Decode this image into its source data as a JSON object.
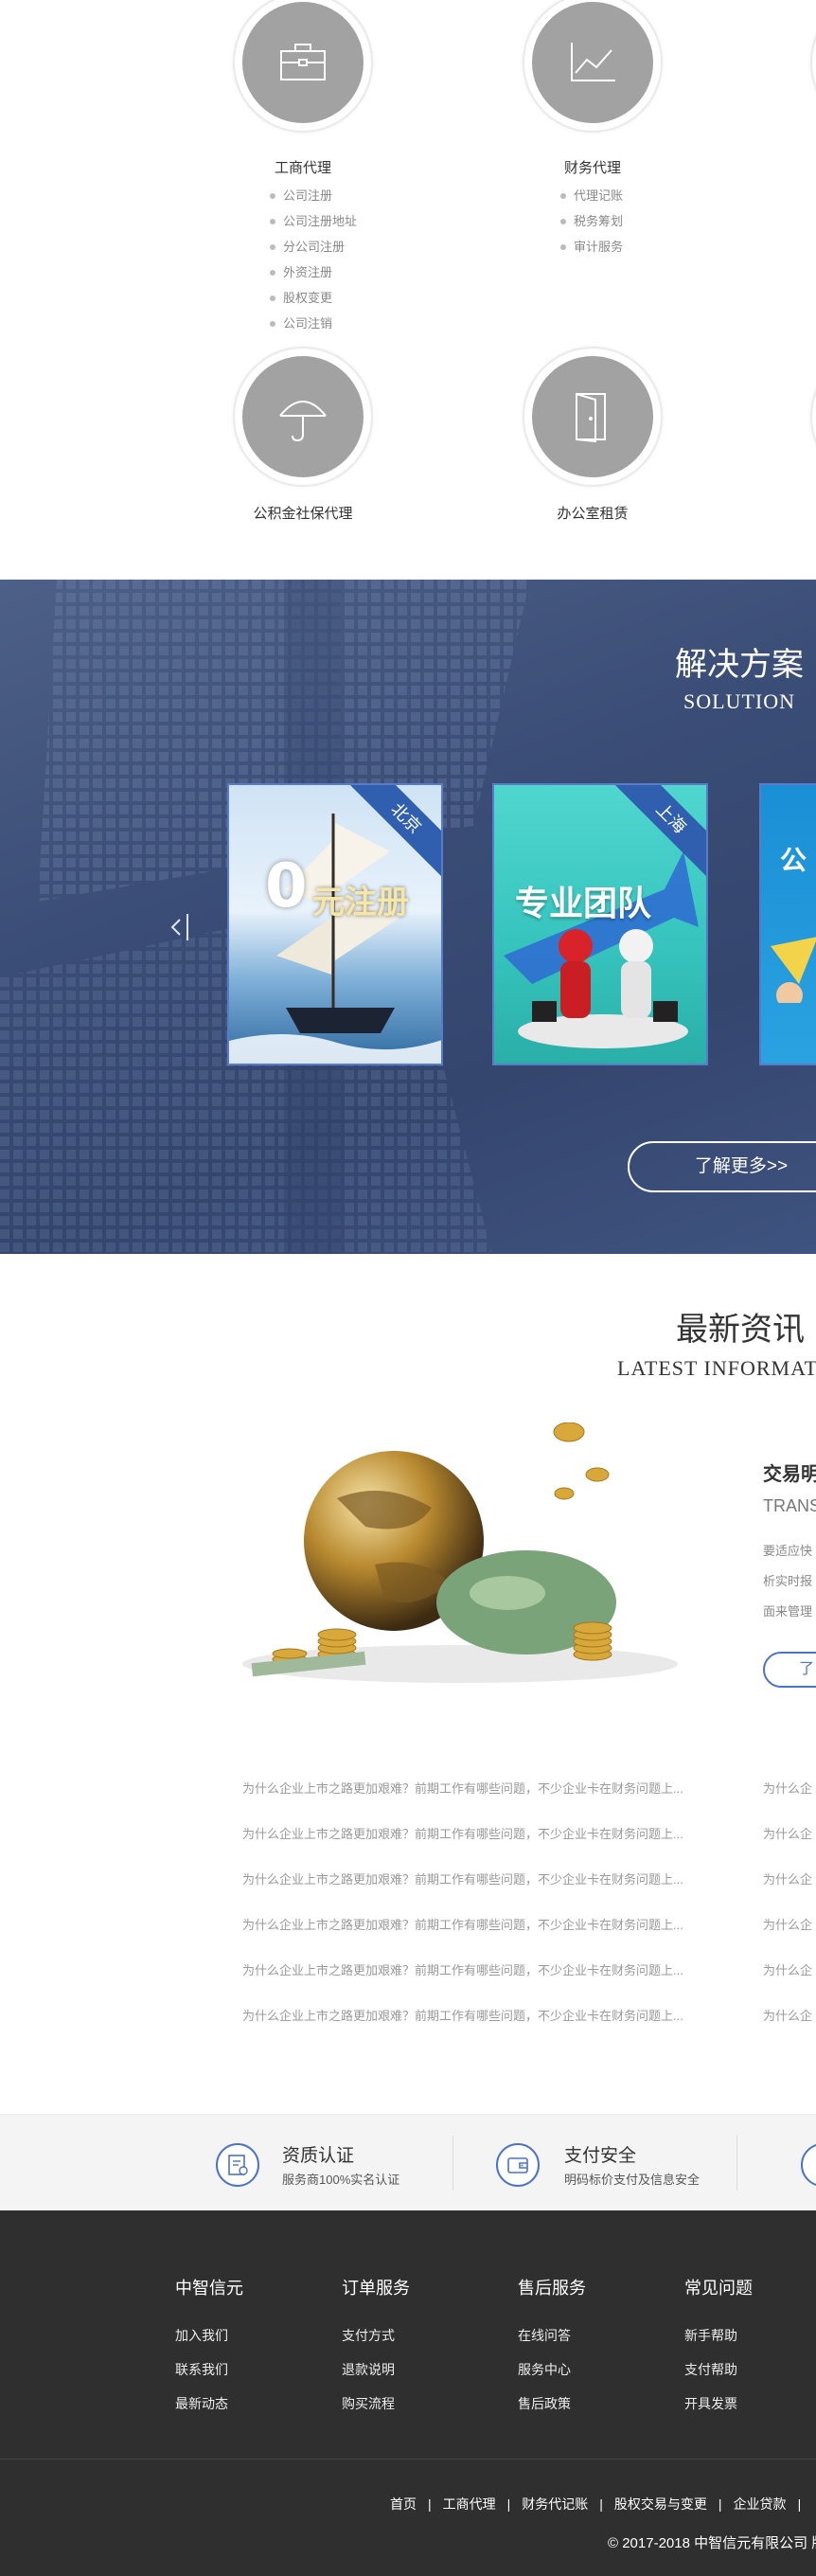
{
  "services": [
    {
      "title": "工商代理",
      "icon": "briefcase-icon",
      "items": [
        "公司注册",
        "公司注册地址",
        "分公司注册",
        "外资注册",
        "股权变更",
        "公司注销"
      ]
    },
    {
      "title": "财务代理",
      "icon": "line-chart-icon",
      "items": [
        "代理记账",
        "税务筹划",
        "审计服务"
      ]
    },
    {
      "title": "公积金社保代理",
      "icon": "umbrella-icon",
      "items": []
    },
    {
      "title": "办公室租赁",
      "icon": "door-icon",
      "items": []
    }
  ],
  "solution": {
    "title": "解决方案",
    "subtitle": "SOLUTION",
    "more_label": "了解更多>>",
    "cards": [
      {
        "ribbon": "北京",
        "caption": "0元注册"
      },
      {
        "ribbon": "上海",
        "caption": "专业团队"
      },
      {
        "caption": "公"
      }
    ]
  },
  "news": {
    "title": "最新资讯",
    "subtitle": "LATEST INFORMAT",
    "featured": {
      "title": "交易明",
      "subtitle": "TRANS",
      "desc": [
        "要适应快",
        "析实时报",
        "面来管理"
      ],
      "button": "了"
    },
    "left_items": [
      "为什么企业上市之路更加艰难？前期工作有哪些问题，不少企业卡在财务问题上...",
      "为什么企业上市之路更加艰难？前期工作有哪些问题，不少企业卡在财务问题上...",
      "为什么企业上市之路更加艰难？前期工作有哪些问题，不少企业卡在财务问题上...",
      "为什么企业上市之路更加艰难？前期工作有哪些问题，不少企业卡在财务问题上...",
      "为什么企业上市之路更加艰难？前期工作有哪些问题，不少企业卡在财务问题上...",
      "为什么企业上市之路更加艰难？前期工作有哪些问题，不少企业卡在财务问题上..."
    ],
    "right_items": [
      "为什么企",
      "为什么企",
      "为什么企",
      "为什么企",
      "为什么企",
      "为什么企"
    ]
  },
  "features": [
    {
      "title": "资质认证",
      "desc": "服务商100%实名认证",
      "icon": "certificate-icon"
    },
    {
      "title": "支付安全",
      "desc": "明码标价支付及信息安全",
      "icon": "wallet-icon"
    }
  ],
  "footer": {
    "columns": [
      {
        "title": "中智信元",
        "links": [
          "加入我们",
          "联系我们",
          "最新动态"
        ]
      },
      {
        "title": "订单服务",
        "links": [
          "支付方式",
          "退款说明",
          "购买流程"
        ]
      },
      {
        "title": "售后服务",
        "links": [
          "在线问答",
          "服务中心",
          "售后政策"
        ]
      },
      {
        "title": "常见问题",
        "links": [
          "新手帮助",
          "支付帮助",
          "开具发票"
        ]
      }
    ],
    "nav": [
      "首页",
      "工商代理",
      "财务代记账",
      "股权交易与变更",
      "企业贷款"
    ],
    "copyright": "© 2017-2018 中智信元有限公司 版"
  }
}
